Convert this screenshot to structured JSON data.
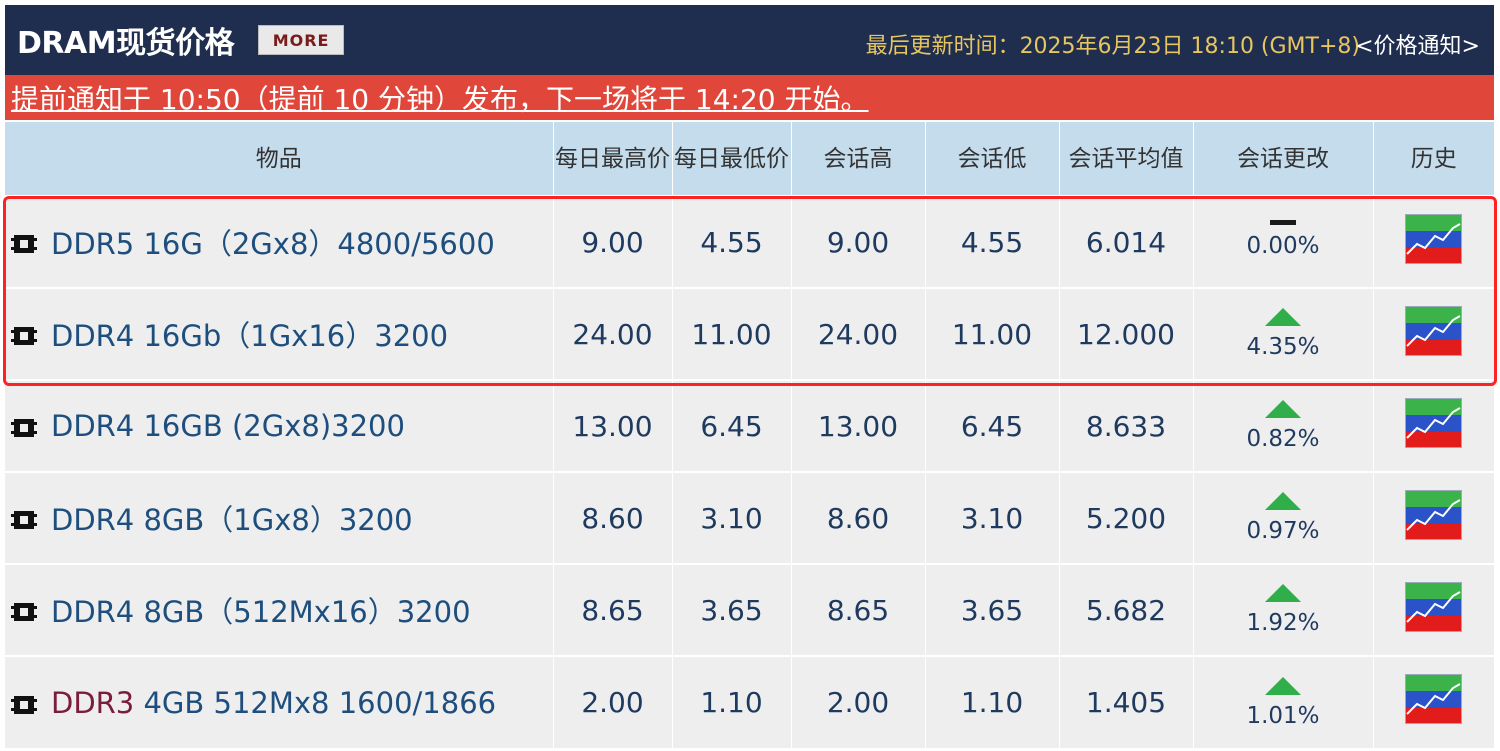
{
  "header": {
    "title": "DRAM现货价格",
    "more_label": "MORE",
    "updated": "最后更新时间：2025年6月23日 18:10 (GMT+8)",
    "price_notice": "<价格通知>"
  },
  "notice": {
    "text": "提前通知于 10:50（提前 10 分钟）发布，下一场将于 14:20 开始。"
  },
  "table": {
    "headers": [
      "物品",
      "每日最高价",
      "每日最低价",
      "会话高",
      "会话低",
      "会话平均值",
      "会话更改",
      "历史"
    ],
    "rows": [
      {
        "name_prefix": "",
        "name": "DDR5 16G（2Gx8）4800/5600",
        "daily_high": "9.00",
        "daily_low": "4.55",
        "session_high": "9.00",
        "session_low": "4.55",
        "session_avg": "6.014",
        "change": "0.00%",
        "direction": "flat"
      },
      {
        "name_prefix": "",
        "name": "DDR4 16Gb（1Gx16）3200",
        "daily_high": "24.00",
        "daily_low": "11.00",
        "session_high": "24.00",
        "session_low": "11.00",
        "session_avg": "12.000",
        "change": "4.35%",
        "direction": "up"
      },
      {
        "name_prefix": "",
        "name": "DDR4 16GB (2Gx8)3200",
        "daily_high": "13.00",
        "daily_low": "6.45",
        "session_high": "13.00",
        "session_low": "6.45",
        "session_avg": "8.633",
        "change": "0.82%",
        "direction": "up"
      },
      {
        "name_prefix": "",
        "name": "DDR4 8GB（1Gx8）3200",
        "daily_high": "8.60",
        "daily_low": "3.10",
        "session_high": "8.60",
        "session_low": "3.10",
        "session_avg": "5.200",
        "change": "0.97%",
        "direction": "up"
      },
      {
        "name_prefix": "",
        "name": "DDR4 8GB（512Mx16）3200",
        "daily_high": "8.65",
        "daily_low": "3.65",
        "session_high": "8.65",
        "session_low": "3.65",
        "session_avg": "5.682",
        "change": "1.92%",
        "direction": "up"
      },
      {
        "name_prefix": "DDR3",
        "name": " 4GB 512Mx8 1600/1866",
        "daily_high": "2.00",
        "daily_low": "1.10",
        "session_high": "2.00",
        "session_low": "1.10",
        "session_avg": "1.405",
        "change": "1.01%",
        "direction": "up"
      }
    ]
  },
  "icons": {
    "chip": "memory-chip-icon",
    "history": "history-chart-icon",
    "up": "up-arrow-icon",
    "flat": "flat-dash-icon"
  },
  "colors": {
    "header_bg": "#1f2e4e",
    "notice_bg": "#e0473a",
    "column_header_bg": "#c4dcec",
    "row_bg": "#eeeeee",
    "up_green": "#2fae4a",
    "highlight_red": "#ff2222"
  }
}
